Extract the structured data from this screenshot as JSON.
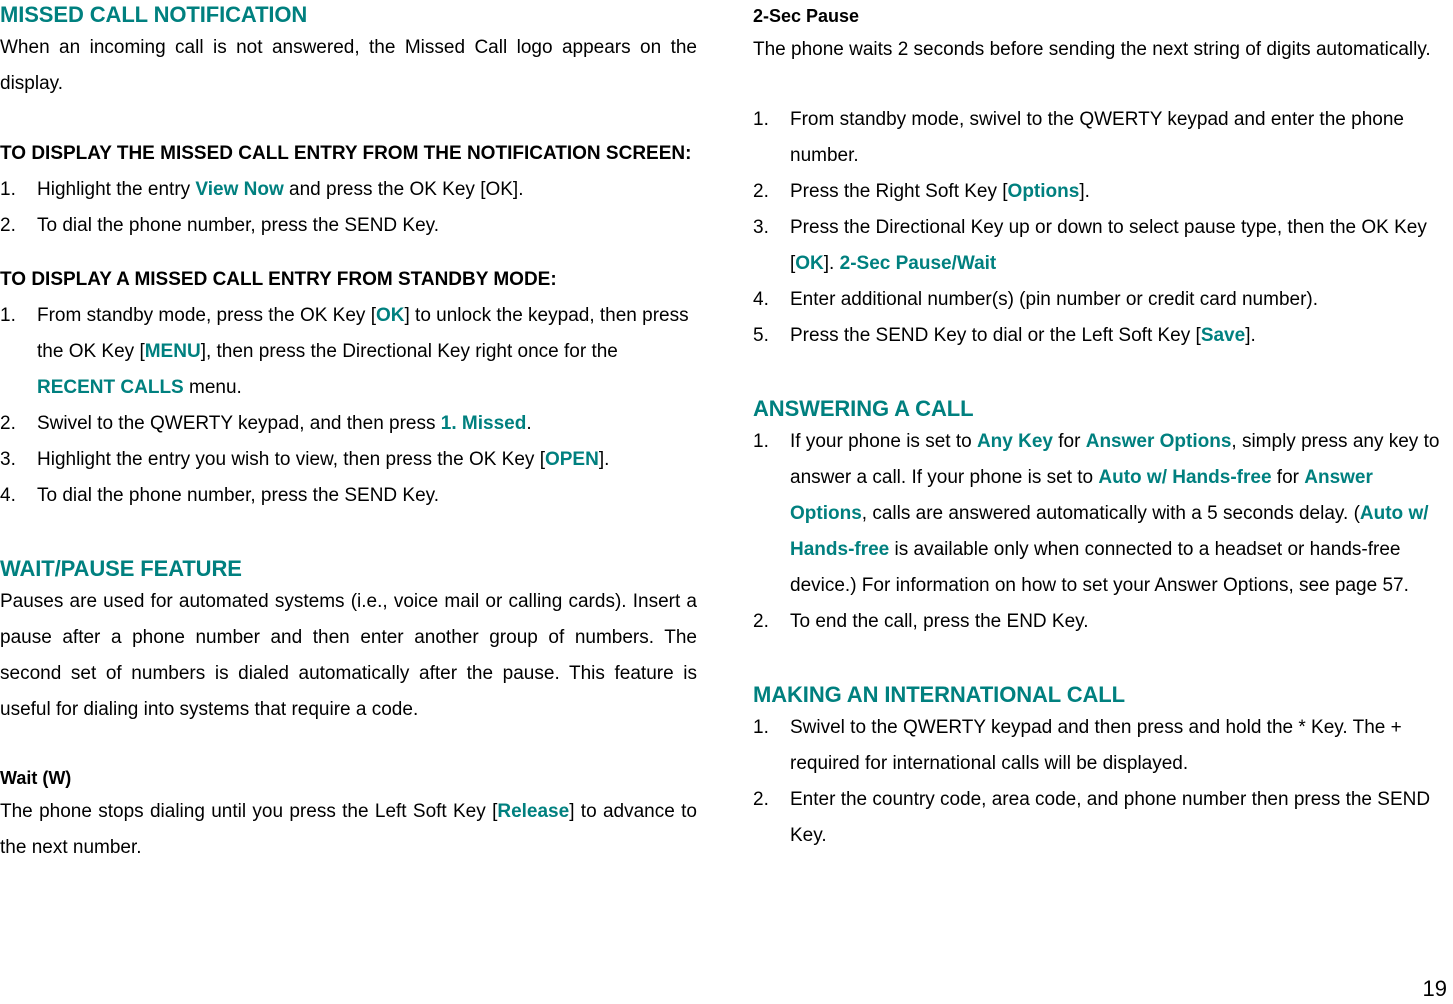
{
  "page": {
    "number": "19",
    "accent_color": "#00807F",
    "text_color": "#000000",
    "background_color": "#FFFFFF"
  },
  "left_column": {
    "section1": {
      "heading": "MISSED CALL NOTIFICATION",
      "paragraph": "When an incoming call is not answered, the Missed Call logo appears on the display."
    },
    "section2": {
      "heading": "TO DISPLAY THE MISSED CALL ENTRY FROM THE NOTIFICATION SCREEN:",
      "steps": [
        {
          "num": "1.",
          "parts": [
            {
              "t": "Highlight the entry ",
              "s": "plain"
            },
            {
              "t": "View Now",
              "s": "teal"
            },
            {
              "t": " and press the OK Key [OK].",
              "s": "plain"
            }
          ]
        },
        {
          "num": "2.",
          "parts": [
            {
              "t": "To dial the phone number, press the SEND Key.",
              "s": "plain"
            }
          ]
        }
      ]
    },
    "section3": {
      "heading": "TO DISPLAY A MISSED CALL ENTRY FROM STANDBY MODE:",
      "steps": [
        {
          "num": "1.",
          "parts": [
            {
              "t": "From standby mode, press the OK Key [",
              "s": "plain"
            },
            {
              "t": "OK",
              "s": "teal"
            },
            {
              "t": "] to unlock the keypad, then press the OK Key [",
              "s": "plain"
            },
            {
              "t": "MENU",
              "s": "teal"
            },
            {
              "t": "], then press the Directional Key right once for the ",
              "s": "plain"
            },
            {
              "t": "RECENT CALLS",
              "s": "teal"
            },
            {
              "t": " menu.",
              "s": "plain"
            }
          ]
        },
        {
          "num": "2.",
          "parts": [
            {
              "t": "Swivel to the QWERTY keypad, and then press ",
              "s": "plain"
            },
            {
              "t": "1. Missed",
              "s": "teal"
            },
            {
              "t": ".",
              "s": "plain"
            }
          ]
        },
        {
          "num": "3.",
          "parts": [
            {
              "t": "Highlight the entry you wish to view, then press the OK Key [",
              "s": "plain"
            },
            {
              "t": "OPEN",
              "s": "teal"
            },
            {
              "t": "].",
              "s": "plain"
            }
          ]
        },
        {
          "num": "4.",
          "parts": [
            {
              "t": "To dial the phone number, press the SEND Key.",
              "s": "plain"
            }
          ]
        }
      ]
    },
    "section4": {
      "heading": "WAIT/PAUSE FEATURE",
      "paragraph": "Pauses are used for automated systems (i.e., voice mail or calling cards). Insert a pause after a phone number and then enter another group of numbers. The second set of numbers is dialed automatically after the pause. This feature is useful for dialing into systems that require a code.",
      "subheading": "Wait (W)",
      "sub_parts": [
        {
          "t": "The phone stops dialing until you press the Left Soft Key [",
          "s": "plain"
        },
        {
          "t": "Release",
          "s": "teal"
        },
        {
          "t": "] to advance to the next number.",
          "s": "plain"
        }
      ]
    }
  },
  "right_column": {
    "section1": {
      "subheading": "2-Sec Pause",
      "paragraph": "The phone waits 2 seconds before sending the next string of digits automatically.",
      "steps": [
        {
          "num": "1.",
          "parts": [
            {
              "t": "From standby mode, swivel to the QWERTY keypad and enter the phone number.",
              "s": "plain"
            }
          ]
        },
        {
          "num": "2.",
          "parts": [
            {
              "t": "Press the Right Soft Key [",
              "s": "plain"
            },
            {
              "t": "Options",
              "s": "teal"
            },
            {
              "t": "].",
              "s": "plain"
            }
          ]
        },
        {
          "num": "3.",
          "parts": [
            {
              "t": "Press the Directional Key up or down to select pause type, then the OK Key [",
              "s": "plain"
            },
            {
              "t": "OK",
              "s": "teal"
            },
            {
              "t": "]. ",
              "s": "plain"
            },
            {
              "t": "2-Sec Pause/Wait",
              "s": "teal"
            }
          ]
        },
        {
          "num": "4.",
          "parts": [
            {
              "t": "Enter additional number(s) (pin number or credit card number).",
              "s": "plain"
            }
          ]
        },
        {
          "num": "5.",
          "parts": [
            {
              "t": "Press the SEND Key to dial or the Left Soft Key [",
              "s": "plain"
            },
            {
              "t": "Save",
              "s": "teal"
            },
            {
              "t": "].",
              "s": "plain"
            }
          ]
        }
      ]
    },
    "section2": {
      "heading": "ANSWERING A CALL",
      "steps": [
        {
          "num": "1.",
          "parts": [
            {
              "t": "If your phone is set to ",
              "s": "plain"
            },
            {
              "t": "Any Key",
              "s": "teal"
            },
            {
              "t": " for ",
              "s": "plain"
            },
            {
              "t": "Answer Options",
              "s": "teal"
            },
            {
              "t": ", simply press any key to answer a call. If your phone is set to ",
              "s": "plain"
            },
            {
              "t": "Auto w/ Hands-free",
              "s": "teal"
            },
            {
              "t": " for ",
              "s": "plain"
            },
            {
              "t": "Answer Options",
              "s": "teal"
            },
            {
              "t": ", calls are answered automatically with a 5 seconds delay. (",
              "s": "plain"
            },
            {
              "t": "Auto w/ Hands-free",
              "s": "teal"
            },
            {
              "t": " is available only when connected to a headset or hands-free device.) For information on how to set your Answer Options, see page 57.",
              "s": "plain"
            }
          ]
        },
        {
          "num": "2.",
          "parts": [
            {
              "t": "To end the call, press the END Key.",
              "s": "plain"
            }
          ]
        }
      ]
    },
    "section3": {
      "heading": "MAKING AN INTERNATIONAL CALL",
      "steps": [
        {
          "num": "1.",
          "parts": [
            {
              "t": "Swivel to the QWERTY keypad and then press and hold the * Key. The + required for international calls will be displayed.",
              "s": "plain"
            }
          ]
        },
        {
          "num": "2.",
          "parts": [
            {
              "t": "Enter the country code, area code, and phone number then press the SEND Key.",
              "s": "plain"
            }
          ]
        }
      ]
    }
  }
}
